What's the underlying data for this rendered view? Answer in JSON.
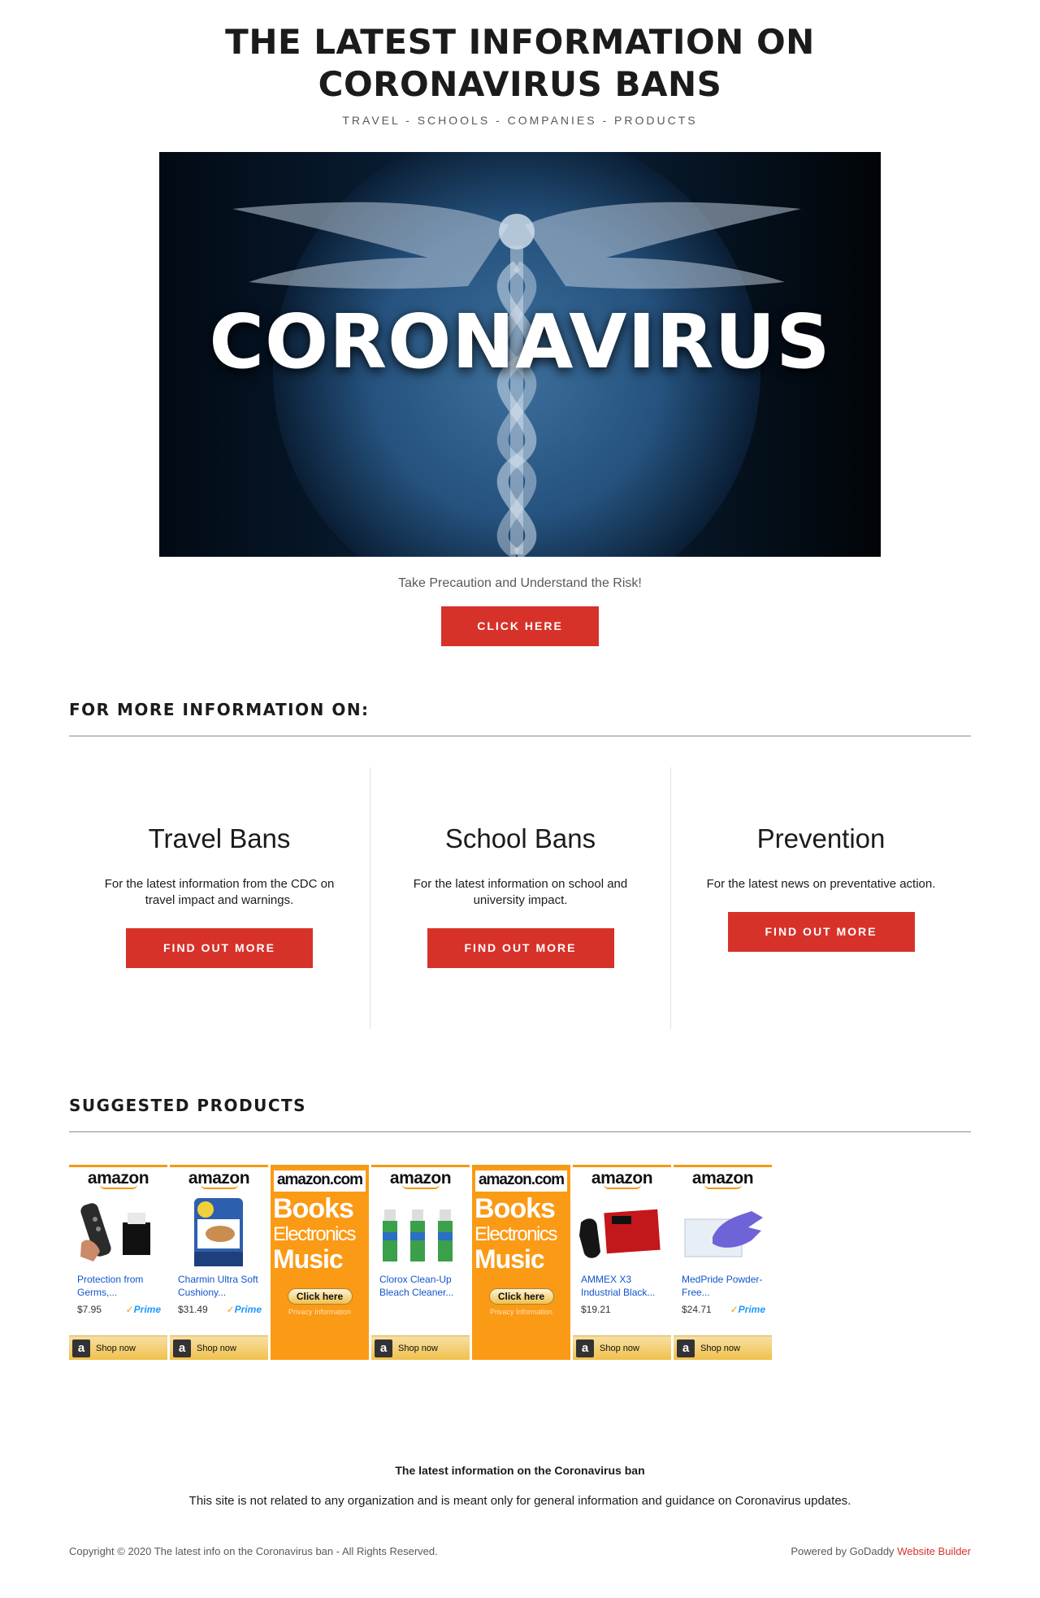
{
  "header": {
    "title": "THE LATEST INFORMATION ON CORONAVIRUS BANS",
    "tagline": "TRAVEL - SCHOOLS - COMPANIES - PRODUCTS"
  },
  "hero": {
    "word": "CORONAVIRUS",
    "subtitle": "Take Precaution and Understand the Risk!",
    "button": "CLICK HERE"
  },
  "more_info": {
    "heading": "FOR MORE INFORMATION ON:",
    "cards": [
      {
        "title": "Travel Bans",
        "text": "For the latest information from the CDC on travel impact and warnings.",
        "button": "FIND OUT MORE"
      },
      {
        "title": "School Bans",
        "text": "For the latest information on school and university impact.",
        "button": "FIND OUT MORE"
      },
      {
        "title": "Prevention",
        "text": "For the latest news on preventative action.",
        "button": "FIND OUT MORE"
      }
    ]
  },
  "products": {
    "heading": "SUGGESTED PRODUCTS",
    "logo": "amazon",
    "shop_label": "Shop now",
    "prime_label": "Prime",
    "items": [
      {
        "name": "Protection from Germs,...",
        "price": "$7.95",
        "prime": true
      },
      {
        "name": "Charmin Ultra Soft Cushiony...",
        "price": "$31.49",
        "prime": true
      },
      {
        "name": "Clorox Clean-Up Bleach Cleaner...",
        "price": "",
        "prime": false
      },
      {
        "name": "AMMEX X3 Industrial Black...",
        "price": "$19.21",
        "prime": false
      },
      {
        "name": "MedPride Powder-Free...",
        "price": "$24.71",
        "prime": true
      }
    ],
    "banner": {
      "logo": "amazon.com",
      "line1": "Books",
      "line2": "Electronics",
      "line3": "Music",
      "button": "Click here",
      "privacy": "Privacy Information"
    }
  },
  "footer": {
    "title": "The latest information on the Coronavirus ban",
    "text": "This site is not related to any organization and is meant only for general information and guidance on Coronavirus updates.",
    "copyright": "Copyright © 2020 The latest info on the Coronavirus ban - All Rights Reserved.",
    "powered_prefix": "Powered by GoDaddy",
    "powered_link": "Website Builder"
  },
  "colors": {
    "accent": "#d6322a",
    "amazon_orange": "#fb9a15",
    "link_blue": "#1155cc"
  }
}
